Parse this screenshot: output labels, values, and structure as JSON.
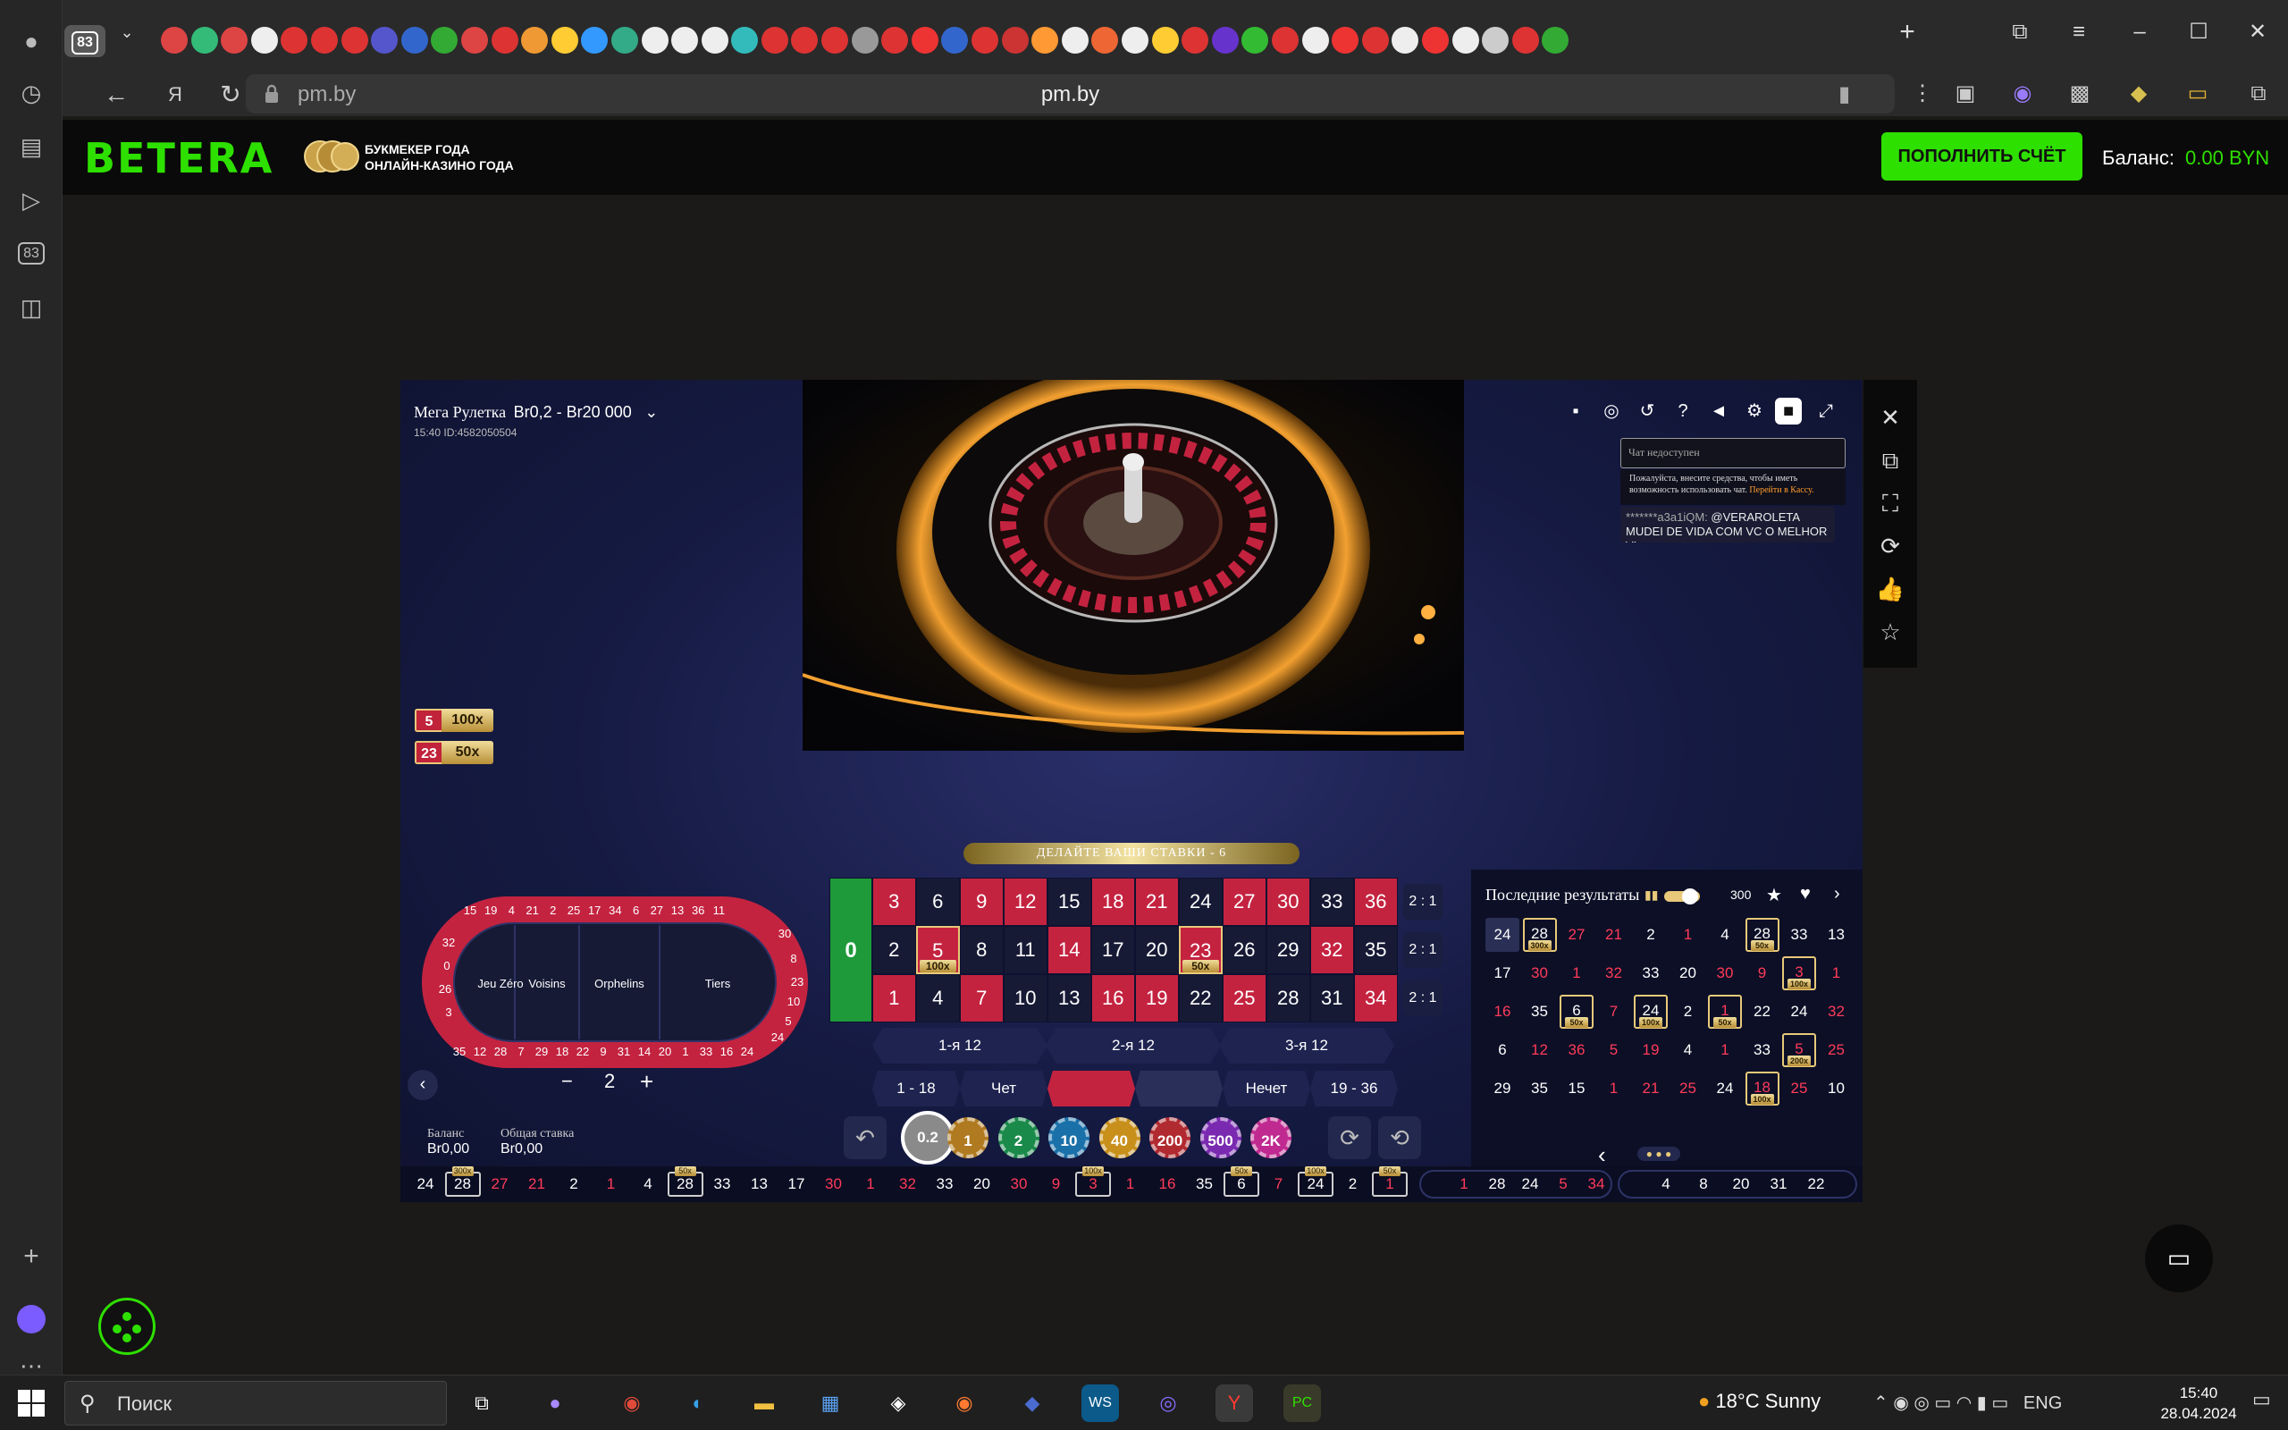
{
  "browser": {
    "tab_count": "83",
    "url_host": "pm.by",
    "page_title": "pm.by",
    "rail_count": "83"
  },
  "site": {
    "logo": "BETERA",
    "tagline_1": "БУКМЕКЕР ГОДА",
    "tagline_2": "ОНЛАЙН-КАЗИНО ГОДА",
    "deposit": "ПОПОЛНИТЬ СЧЁТ",
    "balance_label": "Баланс:",
    "balance_value": "0.00 BYN",
    "brand_color": "#2ee000"
  },
  "game": {
    "title": "Мега Рулетка",
    "limits": "Br0,2 - Br20 000",
    "sub": "15:40 ID:4582050504",
    "chat_placeholder": "Чат недоступен",
    "chat_note": "Пожалуйста, внесите средства, чтобы иметь возможность использовать чат.",
    "chat_note_link": "Перейти в Кассу.",
    "chat_user": "*******a3a1iQM:",
    "chat_handle": "@VERAROLETA",
    "chat_text": "MUDEI DE VIDA COM VC O MELHOR VI...",
    "lucky": [
      {
        "n": "5",
        "m": "100x"
      },
      {
        "n": "23",
        "m": "50x"
      }
    ],
    "banner": "ДЕЛАЙТЕ ВАШИ СТАВКИ - 6",
    "racetrack": {
      "jeu_zero": "Jeu Zéro",
      "voisins": "Voisins",
      "orphelins": "Orphelins",
      "tiers": "Tiers"
    },
    "grid": {
      "zero": "0",
      "col_labels": [
        "2 : 1",
        "2 : 1",
        "2 : 1"
      ],
      "dozens": [
        "1-я 12",
        "2-я 12",
        "3-я 12"
      ],
      "outside": [
        "1 - 18",
        "Чет",
        "",
        "",
        "Нечет",
        "19 - 36"
      ]
    },
    "stepper_value": "2",
    "chips": [
      "0.2",
      "1",
      "2",
      "10",
      "40",
      "200",
      "500",
      "2K"
    ],
    "balance_label": "Баланс",
    "balance_value": "Br0,00",
    "total_label": "Общая ставка",
    "total_value": "Br0,00",
    "results_title": "Последние результаты",
    "results_count": "300"
  },
  "results": [
    [
      "24",
      "28",
      "27",
      "21",
      "2",
      "1",
      "4",
      "28",
      "33",
      "13"
    ],
    [
      "17",
      "30",
      "1",
      "32",
      "33",
      "20",
      "30",
      "9",
      "3",
      "1"
    ],
    [
      "16",
      "35",
      "6",
      "7",
      "24",
      "2",
      "1",
      "22",
      "24",
      "32"
    ],
    [
      "6",
      "12",
      "36",
      "5",
      "19",
      "4",
      "1",
      "33",
      "5",
      "25"
    ],
    [
      "29",
      "35",
      "15",
      "1",
      "21",
      "25",
      "24",
      "18",
      "25",
      "10"
    ]
  ],
  "result_mults": {
    "0-1": "300x",
    "0-7": "50x",
    "1-8": "100x",
    "2-2": "50x",
    "2-4": "100x",
    "2-6": "50x",
    "3-8": "200x",
    "4-7": "100x"
  },
  "history": [
    "24",
    "28",
    "27",
    "21",
    "2",
    "1",
    "4",
    "28",
    "33",
    "13",
    "17",
    "30",
    "1",
    "32",
    "33",
    "20",
    "30",
    "9",
    "3",
    "1",
    "16",
    "35",
    "6",
    "7",
    "24",
    "2",
    "1"
  ],
  "history_tags": {
    "1": "300x",
    "7": "50x",
    "18": "100x",
    "22": "50x",
    "24": "100x",
    "26": "50x"
  },
  "history_group1": [
    "1",
    "28",
    "24",
    "5",
    "34"
  ],
  "history_group2": [
    "4",
    "8",
    "20",
    "31",
    "22"
  ],
  "taskbar": {
    "search": "Поиск",
    "weather": "18°C  Sunny",
    "lang": "ENG",
    "time": "15:40",
    "date": "28.04.2024"
  }
}
